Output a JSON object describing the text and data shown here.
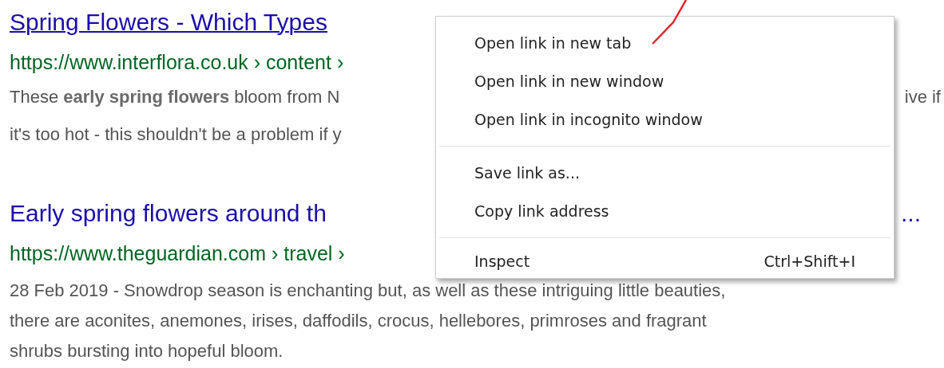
{
  "results": [
    {
      "title": [
        "Spring Flowers - Which Types"
      ],
      "url": "https://www.interflora.co.uk › content ›",
      "snippet_lines": [
        [
          "These **early spring flowers** bloom from N",
          "ive if"
        ],
        [
          "it's too hot - this shouldn't be a problem if y"
        ]
      ]
    },
    {
      "title": [
        "Early spring flowers around th",
        "..."
      ],
      "url": "https://www.theguardian.com › travel ›",
      "snippet_lines": [
        [
          "28 Feb 2019 - Snowdrop season is enchanting but, as well as these intriguing little beauties,"
        ],
        [
          "there are aconites, anemones, irises, daffodils, crocus, hellebores, primroses and fragrant"
        ],
        [
          "shrubs bursting into hopeful bloom."
        ]
      ]
    }
  ],
  "context_menu": {
    "groups": [
      [
        {
          "label": "Open link in new tab"
        },
        {
          "label": "Open link in new window"
        },
        {
          "label": "Open link in incognito window"
        }
      ],
      [
        {
          "label": "Save link as..."
        },
        {
          "label": "Copy link address"
        }
      ],
      [
        {
          "label": "Inspect",
          "shortcut": "Ctrl+Shift+I"
        }
      ]
    ]
  }
}
